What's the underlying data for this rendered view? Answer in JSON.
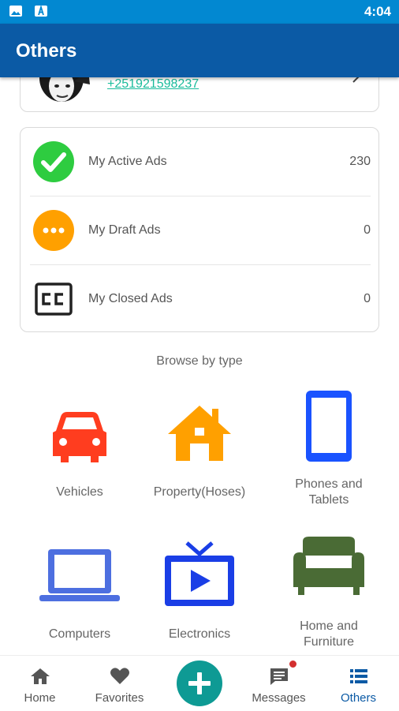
{
  "status_bar": {
    "time": "4:04"
  },
  "app_bar": {
    "title": "Others"
  },
  "profile": {
    "phone": "+251921598237"
  },
  "ads": [
    {
      "label": "My Active Ads",
      "count": "230",
      "icon": "check-circle-icon",
      "color": "#2ecc40"
    },
    {
      "label": "My Draft Ads",
      "count": "0",
      "icon": "more-dots-icon",
      "color": "#ffa000"
    },
    {
      "label": "My Closed Ads",
      "count": "0",
      "icon": "closed-caption-icon",
      "color": "#222222"
    }
  ],
  "browse": {
    "title": "Browse by type",
    "categories": [
      {
        "label": "Vehicles",
        "icon": "car-icon",
        "color": "#ff3d1f"
      },
      {
        "label": "Property(Hoses)",
        "icon": "house-icon",
        "color": "#ffa000"
      },
      {
        "label": "Phones and\nTablets",
        "icon": "phone-icon",
        "color": "#1a53ff"
      },
      {
        "label": "Computers",
        "icon": "laptop-icon",
        "color": "#4d6fe0"
      },
      {
        "label": "Electronics",
        "icon": "tv-icon",
        "color": "#1a3ee6"
      },
      {
        "label": "Home and\nFurniture",
        "icon": "sofa-icon",
        "color": "#4a6b35"
      }
    ]
  },
  "nav": [
    {
      "label": "Home",
      "icon": "home-icon"
    },
    {
      "label": "Favorites",
      "icon": "heart-icon"
    },
    {
      "label": "",
      "icon": "plus-icon"
    },
    {
      "label": "Messages",
      "icon": "message-icon"
    },
    {
      "label": "Others",
      "icon": "list-icon",
      "active": true
    }
  ],
  "colors": {
    "status_bar": "#0288d1",
    "app_bar": "#0b5aa5",
    "accent": "#0e9a94",
    "link": "#1abc9c"
  }
}
